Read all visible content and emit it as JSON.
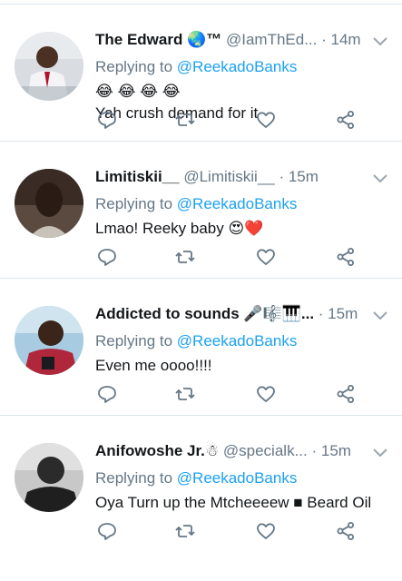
{
  "tweets": [
    {
      "name": "The Edward 🌏™",
      "handle": "@IamThEd...",
      "time": "· 14m",
      "reply_prefix": "Replying to ",
      "reply_to": "@ReekadoBanks",
      "lines": [
        "😂 😂 😂 😂",
        "Yah crush demand for it"
      ],
      "avatar": "white-shirt-man"
    },
    {
      "name": "Limitiskii__",
      "handle": "@Limitiskii__",
      "time": "· 15m",
      "reply_prefix": "Replying to ",
      "reply_to": "@ReekadoBanks",
      "lines": [
        "Lmao! Reeky baby 😍❤️"
      ],
      "avatar": "dark-portrait"
    },
    {
      "name": "Addicted to sounds 🎤🎼🎹...",
      "handle": "",
      "time": "· 15m",
      "reply_prefix": "Replying to ",
      "reply_to": "@ReekadoBanks",
      "lines": [
        "Even me oooo!!!!"
      ],
      "avatar": "selfie-boy"
    },
    {
      "name": "Anifowoshe Jr.☃",
      "handle": "@specialk...",
      "time": "· 15m",
      "reply_prefix": "Replying to ",
      "reply_to": "@ReekadoBanks",
      "lines": [
        "Oya Turn up the Mtcheeeew ■ Beard Oil"
      ],
      "avatar": "bw-man"
    }
  ],
  "icons": [
    "reply-icon",
    "retweet-icon",
    "like-icon",
    "share-icon",
    "caret-down-icon"
  ],
  "colors": {
    "text": "#14171a",
    "muted": "#657786",
    "link": "#1da1f2",
    "divider": "#dfe5ea"
  }
}
